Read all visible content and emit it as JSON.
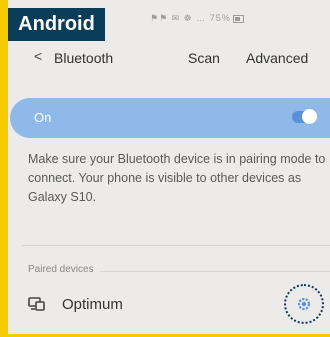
{
  "overlay_label": "Android",
  "status_bar": {
    "text": "⚑⚑ ✉ ☸ … 75%"
  },
  "toolbar": {
    "back_glyph": "<",
    "title": "Bluetooth",
    "scan_label": "Scan",
    "advanced_label": "Advanced"
  },
  "bluetooth_toggle": {
    "label": "On",
    "state": "on"
  },
  "info_text": "Make sure your Bluetooth device is in pairing mode to connect. Your phone is visible to other devices as Galaxy S10.",
  "paired_section": {
    "header": "Paired devices",
    "devices": [
      {
        "name": "Optimum",
        "icon": "computer-icon",
        "settings_icon": "gear-icon"
      }
    ]
  },
  "colors": {
    "accent": "#5b8fd9",
    "toggle_bg": "#8fb9e8",
    "label_bg": "#0a3d57",
    "frame": "#f6c900"
  }
}
